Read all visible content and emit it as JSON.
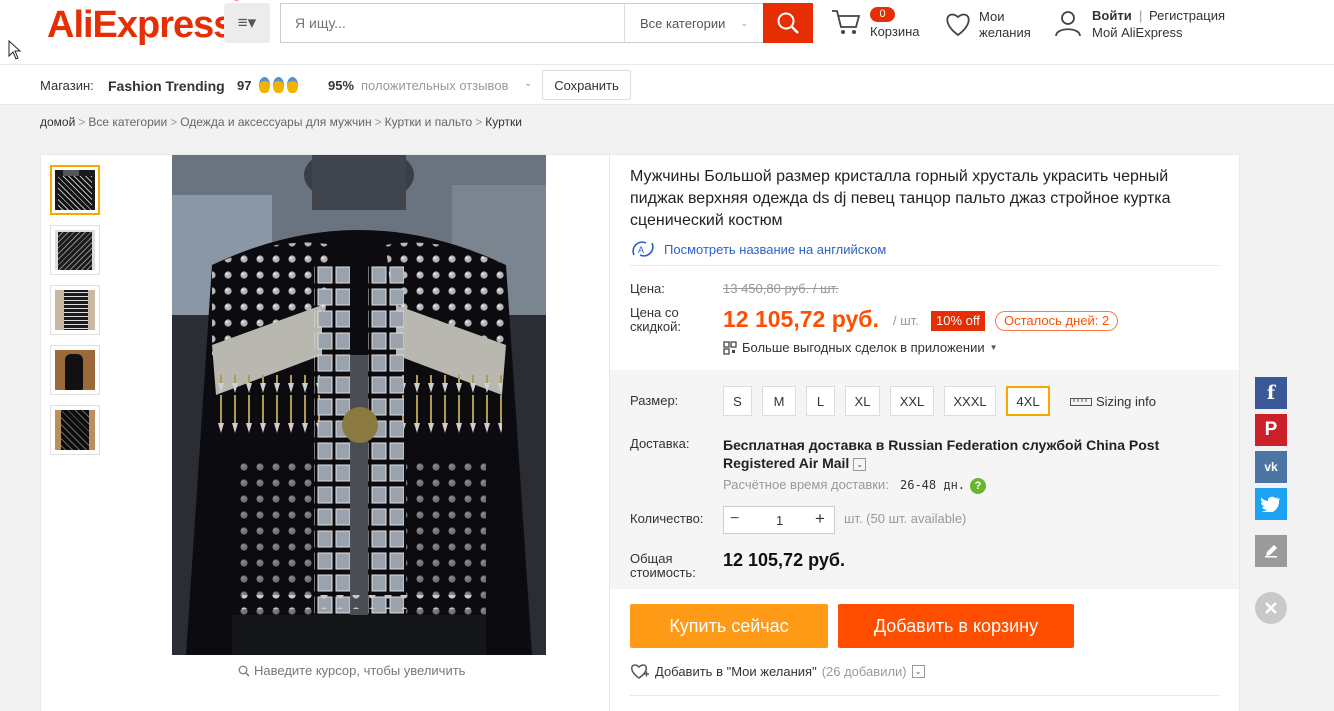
{
  "header": {
    "logo": "AliExpress",
    "search": {
      "placeholder": "Я ищу...",
      "category": "Все категории"
    },
    "cart": {
      "count": "0",
      "label": "Корзина"
    },
    "wishlist": {
      "line1": "Мои",
      "line2": "желания"
    },
    "account": {
      "signin": "Войти",
      "sep": "|",
      "register": "Регистрация",
      "my": "Мой AliExpress"
    }
  },
  "store": {
    "label": "Магазин:",
    "name": "Fashion Trending",
    "score": "97",
    "positive_pct": "95%",
    "positive_label": "положительных отзывов",
    "save_button": "Сохранить"
  },
  "breadcrumb": [
    "домой",
    "Все категории",
    "Одежда и аксессуары для мужчин",
    "Куртки и пальто",
    "Куртки"
  ],
  "breadcrumb_sep": ">",
  "gallery": {
    "thumbnails": [
      "thumb-1",
      "thumb-2",
      "thumb-3",
      "thumb-4",
      "thumb-5"
    ],
    "zoom_hint": "Наведите курсор, чтобы увеличить"
  },
  "product": {
    "title": "Мужчины Большой размер кристалла горный хрусталь украсить черный пиджак верхняя одежда ds dj певец танцор пальто джаз стройное куртка сценический костюм",
    "english_link": "Посмотреть название на английском",
    "price_label": "Цена:",
    "price_old": "13 450,80 руб. / шт.",
    "discount_label_1": "Цена со",
    "discount_label_2": "скидкой:",
    "price_new": "12 105,72 руб.",
    "unit": "/ шт.",
    "discount_badge": "10% off",
    "days_left": "Осталось дней: 2",
    "app_deals": "Больше выгодных сделок в приложении"
  },
  "sku": {
    "size_label": "Размер:",
    "sizes": [
      "S",
      "M",
      "L",
      "XL",
      "XXL",
      "XXXL",
      "4XL"
    ],
    "selected_size": "4XL",
    "sizing_info": "Sizing info",
    "delivery_label": "Доставка:",
    "delivery_free": "Бесплатная доставка в",
    "delivery_country": "Russian Federation",
    "delivery_service_prefix": "службой",
    "delivery_service": "China Post Registered Air Mail",
    "delivery_time_label": "Расчётное время доставки:",
    "delivery_time": "26-48 дн.",
    "qty_label": "Количество:",
    "qty_value": "1",
    "qty_available": "шт. (50 шт. available)",
    "total_label_1": "Общая",
    "total_label_2": "стоимость:",
    "total_value": "12 105,72 руб."
  },
  "actions": {
    "buy_now": "Купить сейчас",
    "add_to_cart": "Добавить в корзину",
    "wishlist_add": "Добавить в \"Мои желания\"",
    "wishlist_count": "(26 добавили)"
  },
  "colors": {
    "brand": "#e62e04",
    "buy": "#ff9a17",
    "cart": "#ff4e00",
    "price": "#ff4e00",
    "selected": "#f7a600",
    "link": "#2a62c9"
  }
}
